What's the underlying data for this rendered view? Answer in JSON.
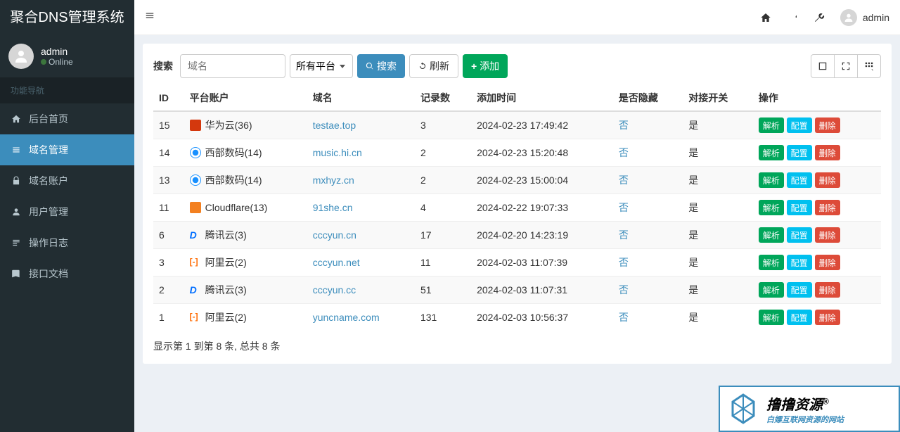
{
  "brand": "聚合DNS管理系统",
  "user": {
    "name": "admin",
    "status": "Online"
  },
  "nav_header": "功能导航",
  "nav": [
    {
      "label": "后台首页"
    },
    {
      "label": "域名管理"
    },
    {
      "label": "域名账户"
    },
    {
      "label": "用户管理"
    },
    {
      "label": "操作日志"
    },
    {
      "label": "接口文档"
    }
  ],
  "header_user": "admin",
  "toolbar": {
    "search_label": "搜索",
    "search_placeholder": "域名",
    "platform_select": "所有平台",
    "search_btn": "搜索",
    "refresh_btn": "刷新",
    "add_btn": "添加"
  },
  "columns": {
    "id": "ID",
    "account": "平台账户",
    "domain": "域名",
    "records": "记录数",
    "add_time": "添加时间",
    "hidden": "是否隐藏",
    "switch": "对接开关",
    "action": "操作"
  },
  "action_labels": {
    "resolve": "解析",
    "config": "配置",
    "delete": "删除"
  },
  "rows": [
    {
      "id": "15",
      "account": "华为云(36)",
      "icon": "huawei",
      "domain": "testae.top",
      "records": "3",
      "time": "2024-02-23 17:49:42",
      "hidden": "否",
      "switch": "是"
    },
    {
      "id": "14",
      "account": "西部数码(14)",
      "icon": "xbsj",
      "domain": "music.hi.cn",
      "records": "2",
      "time": "2024-02-23 15:20:48",
      "hidden": "否",
      "switch": "是"
    },
    {
      "id": "13",
      "account": "西部数码(14)",
      "icon": "xbsj",
      "domain": "mxhyz.cn",
      "records": "2",
      "time": "2024-02-23 15:00:04",
      "hidden": "否",
      "switch": "是"
    },
    {
      "id": "11",
      "account": "Cloudflare(13)",
      "icon": "cf",
      "domain": "91she.cn",
      "records": "4",
      "time": "2024-02-22 19:07:33",
      "hidden": "否",
      "switch": "是"
    },
    {
      "id": "6",
      "account": "腾讯云(3)",
      "icon": "tencent",
      "domain": "cccyun.cn",
      "records": "17",
      "time": "2024-02-20 14:23:19",
      "hidden": "否",
      "switch": "是"
    },
    {
      "id": "3",
      "account": "阿里云(2)",
      "icon": "ali",
      "domain": "cccyun.net",
      "records": "11",
      "time": "2024-02-03 11:07:39",
      "hidden": "否",
      "switch": "是"
    },
    {
      "id": "2",
      "account": "腾讯云(3)",
      "icon": "tencent",
      "domain": "cccyun.cc",
      "records": "51",
      "time": "2024-02-03 11:07:31",
      "hidden": "否",
      "switch": "是"
    },
    {
      "id": "1",
      "account": "阿里云(2)",
      "icon": "ali",
      "domain": "yuncname.com",
      "records": "131",
      "time": "2024-02-03 10:56:37",
      "hidden": "否",
      "switch": "是"
    }
  ],
  "pagination": "显示第 1 到第 8 条, 总共 8 条",
  "watermark": {
    "title": "撸撸资源",
    "reg": "®",
    "sub": "白嫖互联网资源的网站"
  }
}
